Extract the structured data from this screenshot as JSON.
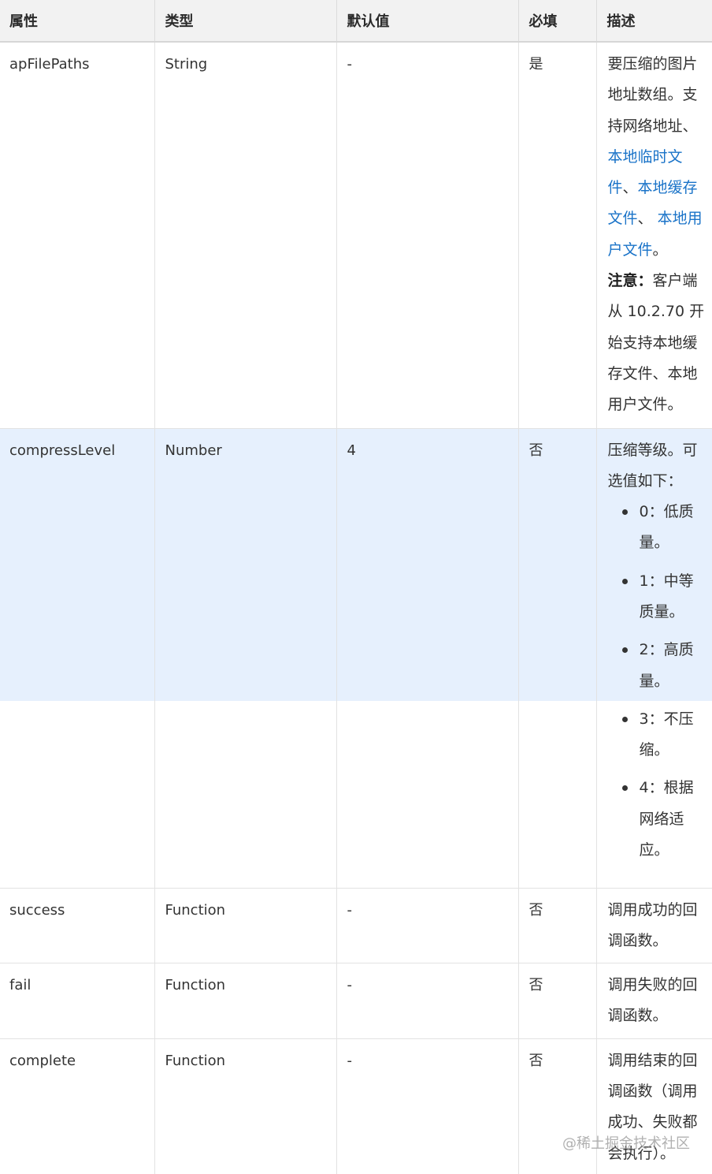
{
  "headers": [
    "属性",
    "类型",
    "默认值",
    "必填",
    "描述"
  ],
  "rows": [
    {
      "name": "apFilePaths",
      "type": "String",
      "default": "-",
      "required": "是",
      "desc": {
        "part1": "要压缩的图片地址数组。支持网络地址、",
        "link1": "本地临时文件",
        "sep1": "、",
        "link2": "本地缓存文件",
        "sep2": "、 ",
        "link3": "本地用户文件",
        "end": "。",
        "note_label": "注意：",
        "note_text": "客户端从 10.2.70 开始支持本地缓存文件、本地用户文件。"
      }
    },
    {
      "name": "compressLevel",
      "type": "Number",
      "default": "4",
      "required": "否",
      "desc": {
        "intro": "压缩等级。可选值如下：",
        "options": [
          "0：低质量。",
          "1：中等质量。",
          "2：高质量。",
          "3：不压缩。",
          "4：根据网络适应。"
        ]
      }
    },
    {
      "name": "success",
      "type": "Function",
      "default": "-",
      "required": "否",
      "desc": "调用成功的回调函数。"
    },
    {
      "name": "fail",
      "type": "Function",
      "default": "-",
      "required": "否",
      "desc": "调用失败的回调函数。"
    },
    {
      "name": "complete",
      "type": "Function",
      "default": "-",
      "required": "否",
      "desc": "调用结束的回调函数（调用成功、失败都会执行）。"
    }
  ],
  "watermark": "@稀土掘金技术社区",
  "colors": {
    "link": "#1a73c8",
    "highlight_row": "#e6f0fd",
    "header_bg": "#f2f2f2"
  }
}
